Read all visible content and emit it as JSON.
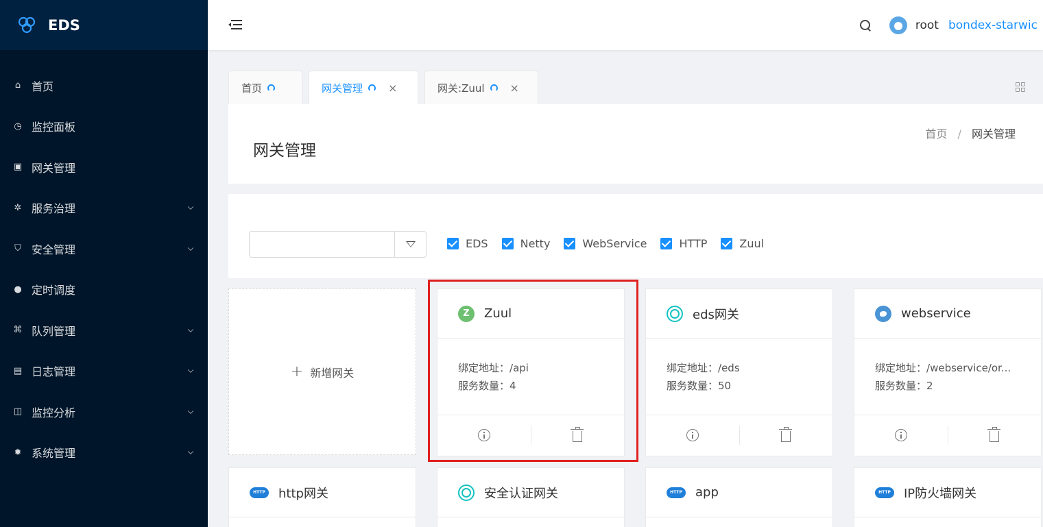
{
  "app": {
    "title": "EDS"
  },
  "sidebar": {
    "items": [
      {
        "label": "首页",
        "icon": "home-icon",
        "has_children": false
      },
      {
        "label": "监控面板",
        "icon": "dashboard-icon",
        "has_children": false
      },
      {
        "label": "网关管理",
        "icon": "gateway-icon",
        "has_children": false
      },
      {
        "label": "服务治理",
        "icon": "gear-icon",
        "has_children": true
      },
      {
        "label": "安全管理",
        "icon": "shield-icon",
        "has_children": true
      },
      {
        "label": "定时调度",
        "icon": "schedule-icon",
        "has_children": false
      },
      {
        "label": "队列管理",
        "icon": "queue-icon",
        "has_children": true
      },
      {
        "label": "日志管理",
        "icon": "log-icon",
        "has_children": true
      },
      {
        "label": "监控分析",
        "icon": "chart-icon",
        "has_children": true
      },
      {
        "label": "系统管理",
        "icon": "settings-icon",
        "has_children": true
      }
    ]
  },
  "header": {
    "user": "root",
    "tenant": "bondex-starwic"
  },
  "tabs": [
    {
      "label": "首页",
      "closable": false,
      "active": false
    },
    {
      "label": "网关管理",
      "closable": true,
      "active": true
    },
    {
      "label": "网关:Zuul",
      "closable": true,
      "active": false
    }
  ],
  "page": {
    "title": "网关管理",
    "breadcrumb": {
      "home": "首页",
      "separator": "/",
      "current": "网关管理"
    }
  },
  "filter": {
    "search_value": "",
    "checkboxes": [
      {
        "label": "EDS",
        "checked": true
      },
      {
        "label": "Netty",
        "checked": true
      },
      {
        "label": "WebService",
        "checked": true
      },
      {
        "label": "HTTP",
        "checked": true
      },
      {
        "label": "Zuul",
        "checked": true
      }
    ]
  },
  "add_card": {
    "plus": "+",
    "label": "新增网关"
  },
  "gateways": [
    {
      "name": "Zuul",
      "icon": "zuul-icon",
      "icon_text": "Z",
      "address_label": "绑定地址：",
      "address": "/api",
      "count_label": "服务数量：",
      "count": "4"
    },
    {
      "name": "eds网关",
      "icon": "eds-icon",
      "address_label": "绑定地址：",
      "address": "/eds",
      "count_label": "服务数量：",
      "count": "50"
    },
    {
      "name": "webservice",
      "icon": "globe-icon",
      "address_label": "绑定地址：",
      "address": "/webservice/or...",
      "count_label": "服务数量：",
      "count": "2"
    },
    {
      "name": "http网关",
      "icon": "http-cloud-icon",
      "icon_text": "HTTP"
    },
    {
      "name": "安全认证网关",
      "icon": "eds-icon"
    },
    {
      "name": "app",
      "icon": "http-cloud-icon",
      "icon_text": "HTTP"
    },
    {
      "name": "IP防火墙网关",
      "icon": "http-cloud-icon",
      "icon_text": "HTTP"
    }
  ],
  "colors": {
    "accent": "#1890ff",
    "sidebar_bg": "#001529",
    "highlight": "#e02020"
  }
}
